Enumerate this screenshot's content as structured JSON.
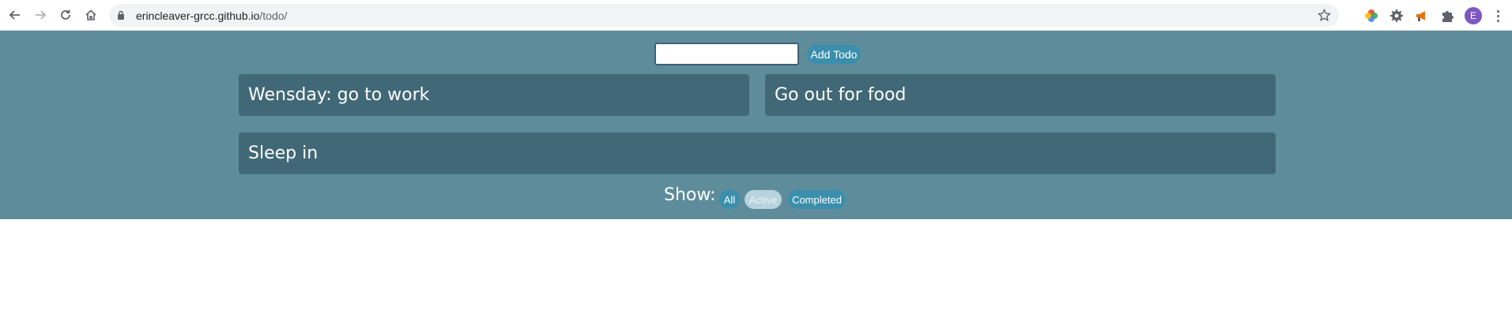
{
  "browser": {
    "url_host": "erincleaver-grcc.github.io",
    "url_path": "/todo/",
    "avatar_letter": "E",
    "extension_icons": [
      "color-wheel-icon",
      "gear-extension-icon",
      "megaphone-icon",
      "puzzle-icon"
    ]
  },
  "app": {
    "background_color": "#5e8c9b",
    "input_value": "",
    "input_placeholder": "",
    "add_button_label": "Add Todo",
    "todos": [
      {
        "text": "Wensday: go to work"
      },
      {
        "text": "Go out for food"
      },
      {
        "text": "Sleep in"
      }
    ],
    "show_label": "Show:",
    "filters": [
      {
        "label": "All",
        "selected": false
      },
      {
        "label": "Active",
        "selected": true
      },
      {
        "label": "Completed",
        "selected": false
      }
    ],
    "accent_color": "#3a8fac"
  }
}
